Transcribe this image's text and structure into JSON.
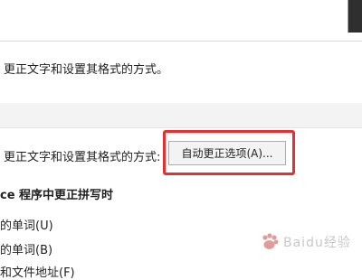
{
  "dialog": {
    "autocorrect_description": "更正文字和设置其格式的方式。",
    "autocorrect_label": "更正文字和设置其格式的方式:",
    "autocorrect_options_button": "自动更正选项(A)...",
    "spelling_section_title": "ce 程序中更正拼写时",
    "options": [
      {
        "label": "的单词(U)"
      },
      {
        "label": "的单词(B)"
      },
      {
        "label": "和文件地址(F)"
      }
    ]
  },
  "watermark": {
    "text": "Baidu经验"
  },
  "colors": {
    "highlight": "#e5302f",
    "section_band": "#f3f3f3",
    "button_face": "#f3f3f3"
  }
}
